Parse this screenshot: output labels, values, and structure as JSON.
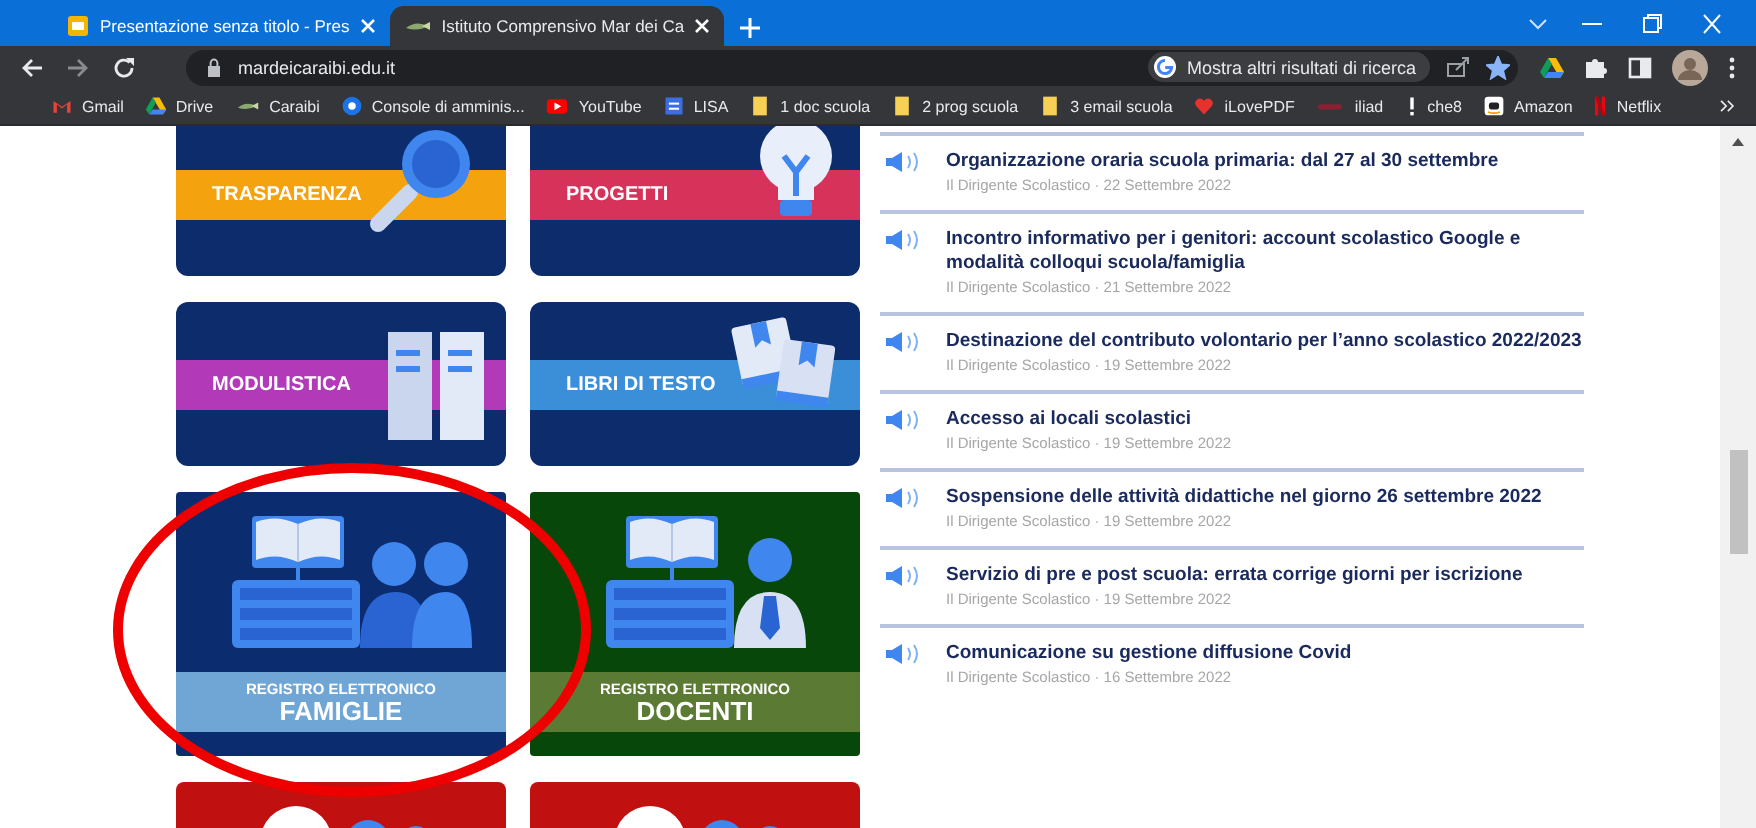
{
  "tabs": [
    {
      "title": "Presentazione senza titolo - Pres",
      "selected": false
    },
    {
      "title": "Istituto Comprensivo Mar dei Ca",
      "selected": true
    }
  ],
  "address_bar": {
    "url": "mardeicaraibi.edu.it",
    "search_chip": "Mostra altri risultati di ricerca",
    "bookmarked": true
  },
  "bookmarks": [
    {
      "label": "Gmail"
    },
    {
      "label": "Drive"
    },
    {
      "label": "Caraibi"
    },
    {
      "label": "Console di amminis..."
    },
    {
      "label": "YouTube"
    },
    {
      "label": "LISA"
    },
    {
      "label": "1 doc scuola"
    },
    {
      "label": "2 prog scuola"
    },
    {
      "label": "3 email scuola"
    },
    {
      "label": "iLovePDF"
    },
    {
      "label": "iliad"
    },
    {
      "label": "che8"
    },
    {
      "label": "Amazon"
    },
    {
      "label": "Netflix"
    }
  ],
  "tiles": [
    {
      "kind": "banner",
      "label": "TRASPARENZA",
      "color": "#f4a30f"
    },
    {
      "kind": "banner",
      "label": "PROGETTI",
      "color": "#d6325a"
    },
    {
      "kind": "banner",
      "label": "MODULISTICA",
      "color": "#b23ab8"
    },
    {
      "kind": "banner",
      "label": "LIBRI DI TESTO",
      "color": "#3a8fd8"
    },
    {
      "kind": "registro",
      "subtitle": "REGISTRO ELETTRONICO",
      "title": "FAMIGLIE",
      "color": "#6fa6d6"
    },
    {
      "kind": "registro",
      "subtitle": "REGISTRO ELETTRONICO",
      "title": "DOCENTI",
      "color": "#5b7b34"
    },
    {
      "kind": "partial",
      "color": "#c0100f"
    },
    {
      "kind": "partial",
      "color": "#c0100f"
    }
  ],
  "news": [
    {
      "title": "Organizzazione oraria scuola primaria: dal 27 al 30 settembre",
      "meta": "Il Dirigente Scolastico · 22 Settembre 2022"
    },
    {
      "title": "Incontro informativo per i genitori: account scolastico Google e modalità colloqui scuola/famiglia",
      "meta": "Il Dirigente Scolastico · 21 Settembre 2022"
    },
    {
      "title": "Destinazione del contributo volontario per l’anno scolastico 2022/2023",
      "meta": "Il Dirigente Scolastico · 19 Settembre 2022"
    },
    {
      "title": "Accesso ai locali scolastici",
      "meta": "Il Dirigente Scolastico · 19 Settembre 2022"
    },
    {
      "title": "Sospensione delle attività didattiche nel giorno 26 settembre 2022",
      "meta": "Il Dirigente Scolastico · 19 Settembre 2022"
    },
    {
      "title": "Servizio di pre e post scuola: errata corrige giorni per iscrizione",
      "meta": "Il Dirigente Scolastico · 19 Settembre 2022"
    },
    {
      "title": "Comunicazione su gestione diffusione Covid",
      "meta": "Il Dirigente Scolastico · 16 Settembre 2022"
    }
  ],
  "annotation": {
    "kind": "ellipse",
    "color": "#ee0000"
  }
}
